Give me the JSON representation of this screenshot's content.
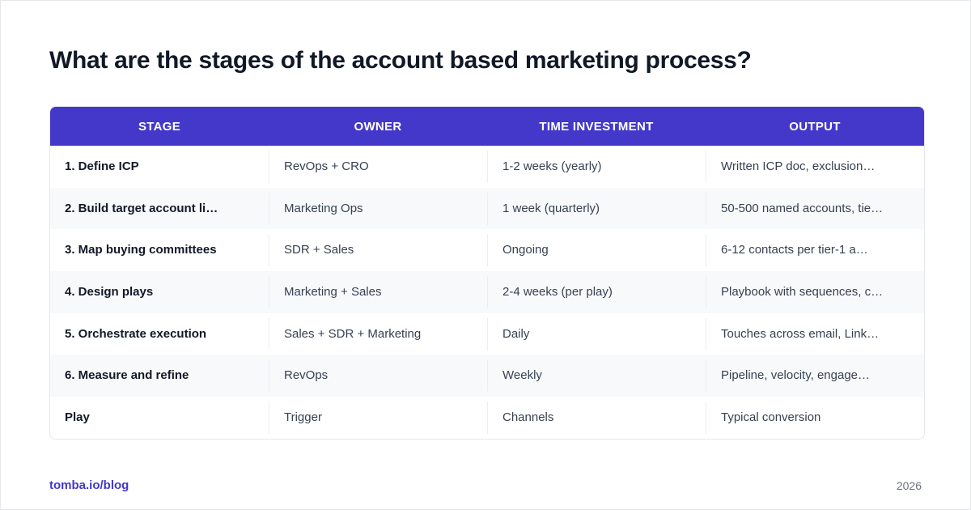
{
  "title": "What are the stages of the account based marketing process?",
  "colors": {
    "header_bg": "#4338ca",
    "brand": "#4338ca",
    "row_alt_bg": "#f8f9fb",
    "text": "#374151",
    "title": "#111827"
  },
  "table": {
    "columns": [
      "STAGE",
      "OWNER",
      "TIME INVESTMENT",
      "OUTPUT"
    ],
    "rows": [
      [
        "1. Define ICP",
        "RevOps + CRO",
        "1-2 weeks (yearly)",
        "Written ICP doc, exclusion…"
      ],
      [
        "2. Build target account li…",
        "Marketing Ops",
        "1 week (quarterly)",
        "50-500 named accounts, tie…"
      ],
      [
        "3. Map buying committees",
        "SDR + Sales",
        "Ongoing",
        "6-12 contacts per tier-1 a…"
      ],
      [
        "4. Design plays",
        "Marketing + Sales",
        "2-4 weeks (per play)",
        "Playbook with sequences, c…"
      ],
      [
        "5. Orchestrate execution",
        "Sales + SDR + Marketing",
        "Daily",
        "Touches across email, Link…"
      ],
      [
        "6. Measure and refine",
        "RevOps",
        "Weekly",
        "Pipeline, velocity, engage…"
      ],
      [
        "Play",
        "Trigger",
        "Channels",
        "Typical conversion"
      ]
    ]
  },
  "footer": {
    "brand": "tomba.io/blog",
    "year": "2026"
  }
}
